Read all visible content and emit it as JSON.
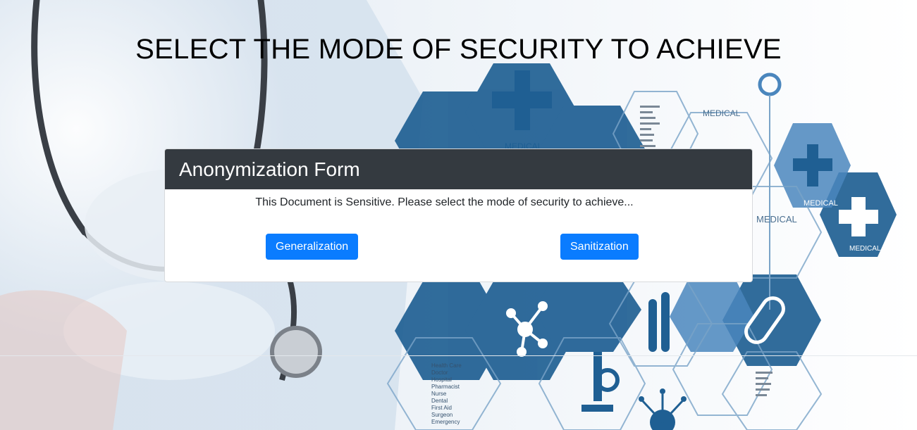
{
  "page": {
    "title": "SELECT THE MODE OF SECURITY TO ACHIEVE"
  },
  "form": {
    "header": "Anonymization Form",
    "message": "This Document is Sensitive. Please select the mode of security to achieve...",
    "buttons": {
      "generalization": "Generalization",
      "sanitization": "Sanitization"
    }
  },
  "background": {
    "hex_labels": [
      "MEDICAL",
      "MEDICAL",
      "MEDICAL",
      "MEDICAL",
      "MEDICAL"
    ],
    "hex_list": [
      "Health Care",
      "Doctor",
      "Hospital",
      "Pharmacist",
      "Nurse",
      "Dental",
      "First Aid",
      "Surgeon",
      "Emergency"
    ]
  },
  "colors": {
    "header_bg": "#343a40",
    "primary": "#0a7cff",
    "hex_blue": "#1f5f93"
  }
}
